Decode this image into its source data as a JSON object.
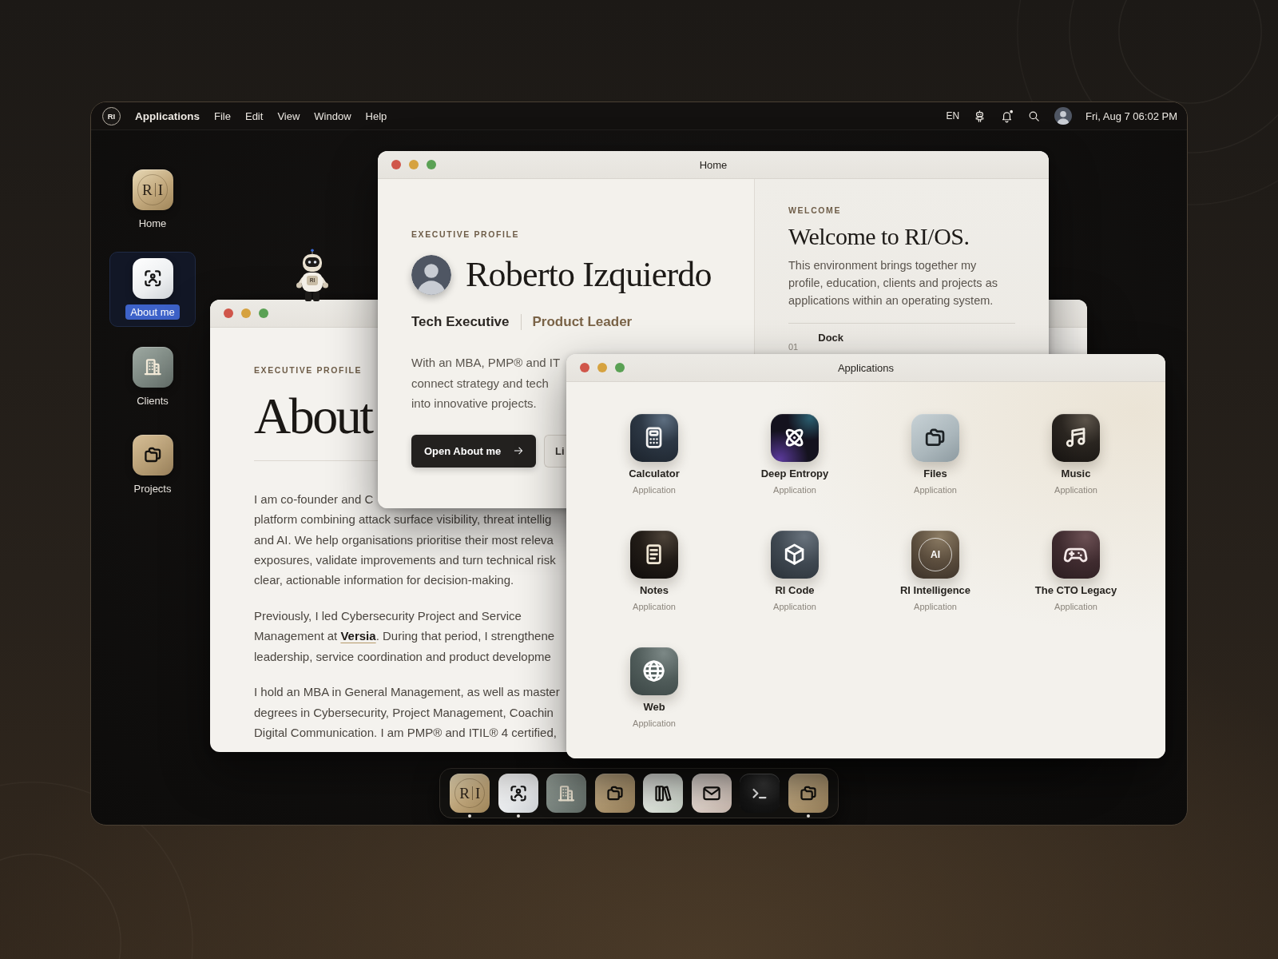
{
  "menu_bar": {
    "logo": "RI",
    "app_name": "Applications",
    "menus": [
      "File",
      "Edit",
      "View",
      "Window",
      "Help"
    ],
    "status_items": [
      {
        "kind": "language",
        "label": "EN"
      },
      {
        "kind": "robot"
      },
      {
        "kind": "bell",
        "unread": true
      },
      {
        "kind": "search"
      },
      {
        "kind": "avatar"
      }
    ],
    "clock": "Fri, Aug 7 06:02 PM"
  },
  "desktop_icons": [
    {
      "kind": "monogram",
      "letters": [
        "R",
        "I"
      ],
      "label": "Home",
      "selected": false
    },
    {
      "kind": "face-scan",
      "label": "About me",
      "selected": true
    },
    {
      "kind": "building",
      "label": "Clients",
      "selected": false
    },
    {
      "kind": "folders",
      "label": "Projects",
      "selected": false
    }
  ],
  "mascot": {
    "badge": "RI"
  },
  "about_window": {
    "eyebrow": "EXECUTIVE PROFILE",
    "heading": "About",
    "paragraphs": [
      {
        "lines": [
          "I am co-founder and C",
          "platform combining attack surface visibility, threat intellig",
          "and AI. We help organisations prioritise their most releva",
          "exposures, validate improvements and turn technical risk",
          "clear, actionable information for decision-making."
        ]
      },
      {
        "lines": [
          "Previously, I led Cybersecurity Project and Service",
          {
            "before": "Management at ",
            "link": "Versia",
            "after": ". During that period, I strengthene"
          },
          "leadership, service coordination and product developme"
        ]
      },
      {
        "lines": [
          "I hold an MBA in General Management, as well as master",
          "degrees in Cybersecurity, Project Management, Coachin",
          "Digital Communication. I am PMP® and ITIL® 4 certified,"
        ]
      }
    ]
  },
  "home_window": {
    "title": "Home",
    "eyebrow": "EXECUTIVE PROFILE",
    "name": "Roberto Izquierdo",
    "roles": [
      "Tech Executive",
      "Product Leader"
    ],
    "intro_lines": [
      "With an MBA, PMP® and IT",
      "connect strategy and tech",
      "into innovative projects."
    ],
    "buttons": [
      {
        "kind": "primary",
        "label": "Open About me"
      },
      {
        "kind": "secondary",
        "label": "Li"
      }
    ],
    "welcome": {
      "eyebrow": "WELCOME",
      "title": "Welcome to RI/OS.",
      "text": "This environment brings together my profile, education, clients and projects as applications within an operating system.",
      "steps": [
        {
          "number": "01",
          "title": "Dock"
        }
      ]
    }
  },
  "applications_window": {
    "title": "Applications",
    "apps": [
      {
        "name": "Calculator",
        "type": "Application",
        "kind": "calculator"
      },
      {
        "name": "Deep Entropy",
        "type": "Application",
        "kind": "atom"
      },
      {
        "name": "Files",
        "type": "Application",
        "kind": "folders"
      },
      {
        "name": "Music",
        "type": "Application",
        "kind": "music"
      },
      {
        "name": "Notes",
        "type": "Application",
        "kind": "notes"
      },
      {
        "name": "RI Code",
        "type": "Application",
        "kind": "cube"
      },
      {
        "name": "RI Intelligence",
        "type": "Application",
        "kind": "badge",
        "badge": "AI"
      },
      {
        "name": "The CTO Legacy",
        "type": "Application",
        "kind": "gamepad"
      },
      {
        "name": "Web",
        "type": "Application",
        "kind": "globe"
      }
    ]
  },
  "dock": [
    {
      "kind": "monogram",
      "letters": [
        "R",
        "I"
      ],
      "running": true
    },
    {
      "kind": "face-scan",
      "running": true
    },
    {
      "kind": "building",
      "running": false
    },
    {
      "kind": "folders",
      "running": false
    },
    {
      "kind": "books",
      "running": false
    },
    {
      "kind": "mail",
      "running": false
    },
    {
      "kind": "terminal",
      "running": false
    },
    {
      "kind": "folders",
      "running": true
    }
  ]
}
